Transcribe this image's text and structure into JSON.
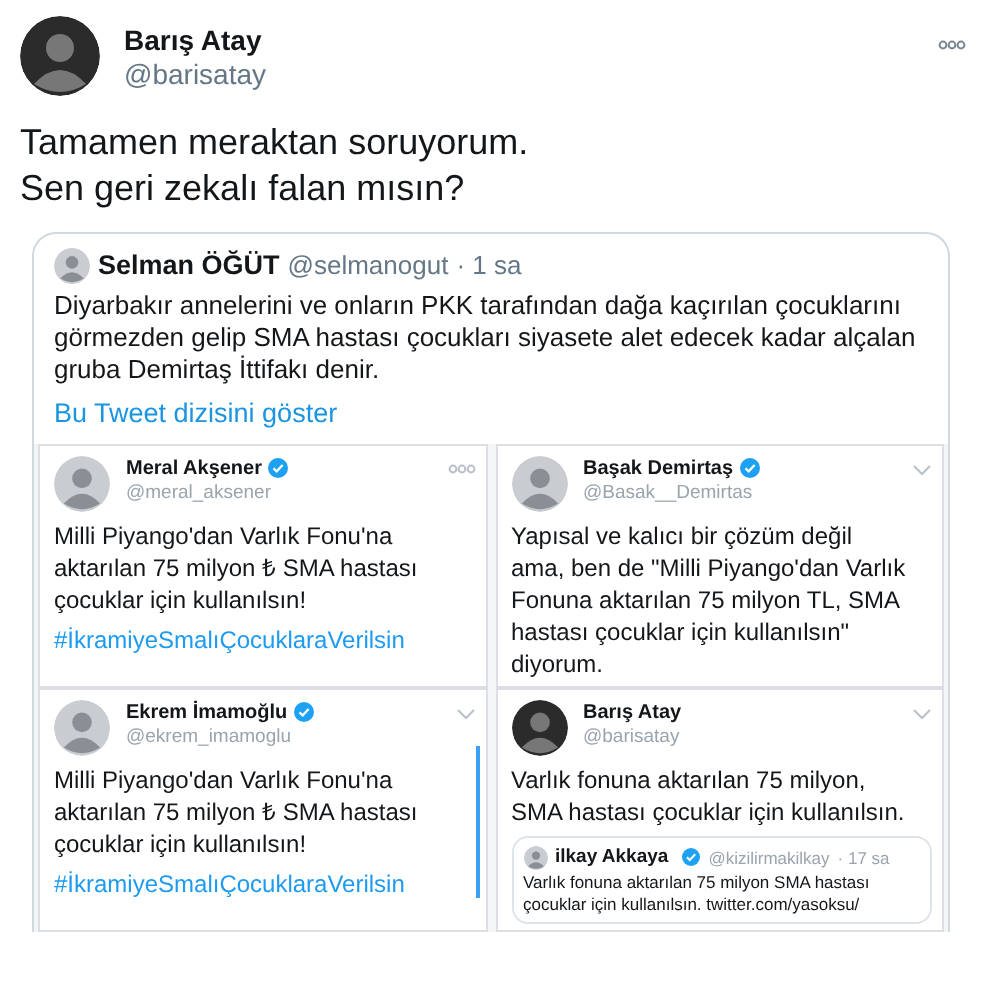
{
  "tweet": {
    "name": "Barış Atay",
    "handle": "@barisatay",
    "text": "Tamamen meraktan soruyorum.\nSen geri zekalı falan mısın?"
  },
  "quoted_tweet": {
    "name": "Selman ÖĞÜT",
    "handle": "@selmanogut",
    "time": "· 1 sa",
    "text": "Diyarbakır annelerini ve onların PKK tarafından dağa kaçırılan çocuklarını görmezden gelip SMA hastası çocukları siyasete alet edecek kadar alçalan gruba Demirtaş İttifakı denir.",
    "thread_link": "Bu Tweet dizisini göster",
    "image_tweets": [
      {
        "name": "Meral Akşener",
        "handle": "@meral_aksener",
        "verified": true,
        "kind": "dots",
        "text": "Milli Piyango'dan Varlık Fonu'na\naktarılan 75 milyon ₺ SMA hastası\nçocuklar için kullanılsın!",
        "hashtag": "#İkramiyeSmalıÇocuklaraVerilsin"
      },
      {
        "name": "Başak Demirtaş",
        "handle": "@Basak__Demirtas",
        "verified": true,
        "kind": "chevron",
        "text": "Yapısal ve kalıcı bir çözüm değil\nama, ben de \"Milli Piyango'dan Varlık\nFonuna aktarılan 75 milyon TL, SMA\nhastası çocuklar için kullanılsın\"\ndiyorum."
      },
      {
        "name": "Ekrem İmamoğlu",
        "handle": "@ekrem_imamoglu",
        "verified": true,
        "kind": "chevron",
        "scrollbar": true,
        "text": "Milli Piyango'dan Varlık Fonu'na\naktarılan 75 milyon ₺ SMA hastası\nçocuklar için kullanılsın!",
        "hashtag": "#İkramiyeSmalıÇocuklaraVerilsin"
      },
      {
        "name": "Barış Atay",
        "handle": "@barisatay",
        "verified": false,
        "kind": "chevron",
        "text": "Varlık fonuna aktarılan 75 milyon,\nSMA hastası çocuklar için kullanılsın.",
        "quote": {
          "name": "ilkay Akkaya",
          "handle": "@kizilirmakilkay",
          "time": "· 17 sa",
          "verified": true,
          "text": "Varlık fonuna aktarılan 75 milyon SMA hastası\nçocuklar için kullanılsın. twitter.com/yasoksu/"
        }
      }
    ]
  }
}
